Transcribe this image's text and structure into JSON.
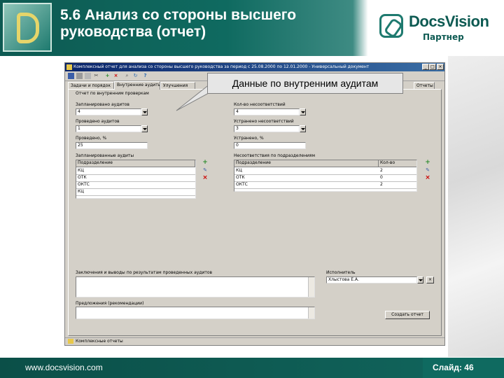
{
  "slide": {
    "title_line1": "5.6 Анализ со стороны высшего",
    "title_line2": "руководства (отчет)",
    "brand_name": "DocsVision",
    "brand_sub": "Партнер",
    "footer_url": "www.docsvision.com",
    "slide_number": "Слайд: 46",
    "colors": {
      "header": "#0d5a52",
      "footer": "#0b4f48",
      "accent": "#1e7a6f"
    }
  },
  "callout": {
    "text": "Данные по внутренним аудитам"
  },
  "window": {
    "title": "Комплексный отчет для анализа со стороны высшего руководства за период с 25.08.2000 по 12.01.2000 - Универсальный документ",
    "controls": {
      "minimize": "_",
      "maximize": "□",
      "close": "×"
    },
    "toolbar_icons": [
      "save-icon",
      "print-icon",
      "copy-icon",
      "cut-icon",
      "add-icon",
      "delete-icon",
      "attach-icon",
      "refresh-icon",
      "help-icon"
    ],
    "tabs": [
      "Задачи и порядок",
      "Внутренние аудиты",
      "Улучшения",
      "Отчеты"
    ],
    "active_tab": 1,
    "section_title": "Отчет по внутренним проверкам",
    "left": {
      "planned_label": "Запланировано аудитов",
      "planned_value": "4",
      "done_label": "Проведено аудитов",
      "done_value": "1",
      "percent_label": "Проведено, %",
      "percent_value": "25",
      "list_label": "Запланированные аудиты",
      "columns": [
        "Подразделение"
      ],
      "rows": [
        "КЦ",
        "ОТК",
        "ОКТС",
        "КЦ"
      ]
    },
    "right": {
      "found_label": "Кол-во несоответствий",
      "found_value": "4",
      "fixed_label": "Устранено несоответствий",
      "fixed_value": "3",
      "fixed_percent_label": "Устранено, %",
      "fixed_percent_value": "0",
      "list_label": "Несоответствия по подразделениям",
      "columns": [
        "Подразделение",
        "Кол-во"
      ],
      "rows": [
        {
          "dept": "КЦ",
          "count": "2"
        },
        {
          "dept": "ОТК",
          "count": "0"
        },
        {
          "dept": "ОКТС",
          "count": "2"
        }
      ]
    },
    "conclusions_label": "Заключения и выводы по результатам проведенных аудитов",
    "suggestions_label": "Предложения (рекомендации)",
    "author_label": "Исполнитель",
    "author_value": "Хлыстова Е.А.",
    "action_button": "Создать отчет",
    "status_text": "Комплексные отчеты"
  }
}
